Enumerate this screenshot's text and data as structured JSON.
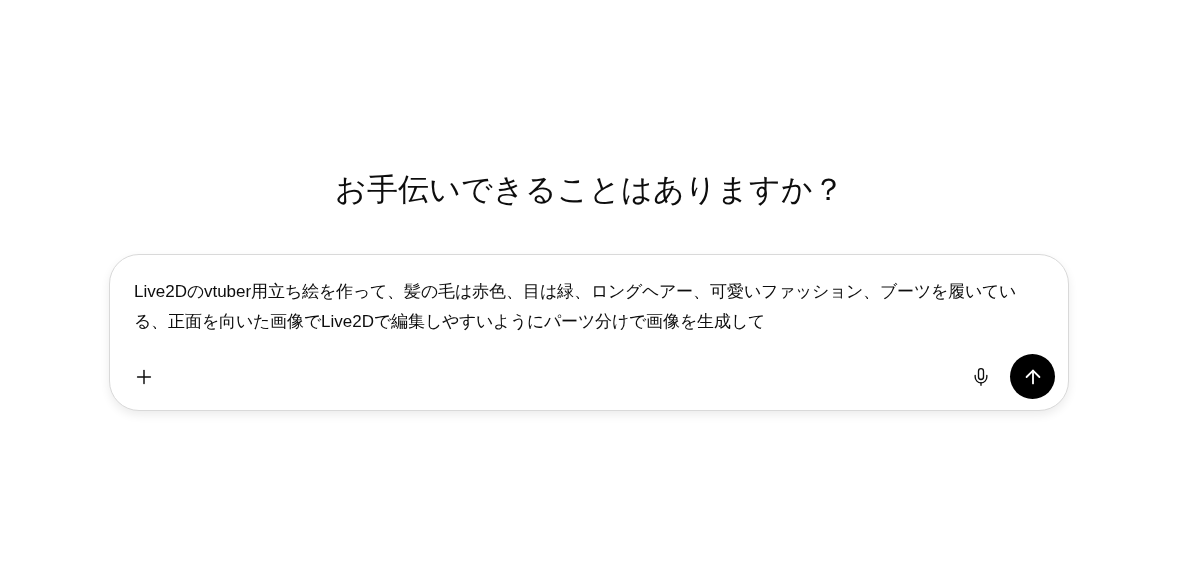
{
  "heading": "お手伝いできることはありますか？",
  "composer": {
    "value": "Live2Dのvtuber用立ち絵を作って、髪の毛は赤色、目は緑、ロングヘアー、可愛いファッション、ブーツを履いている、正面を向いた画像でLive2Dで編集しやすいようにパーツ分けで画像を生成して"
  }
}
